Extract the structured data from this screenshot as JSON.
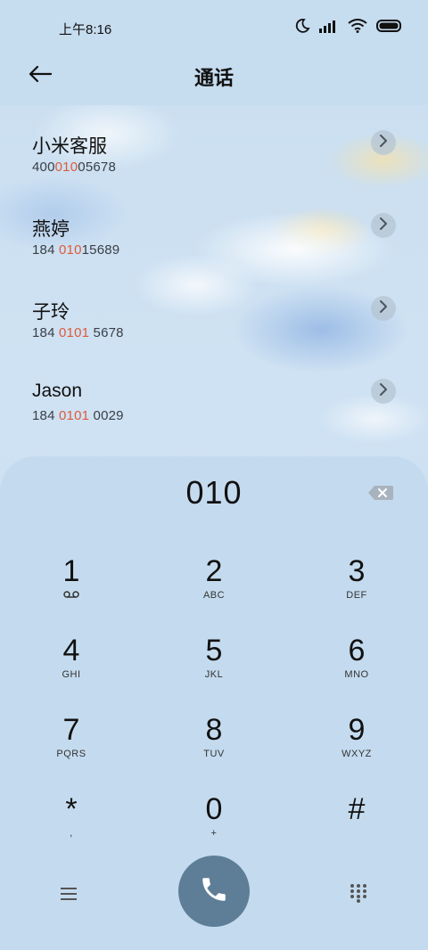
{
  "status": {
    "time": "上午8:16",
    "icons": [
      "moon-icon",
      "signal-icon",
      "wifi-icon",
      "battery-icon"
    ]
  },
  "header": {
    "title": "通话",
    "back_icon": "arrow-left-icon"
  },
  "contacts": [
    {
      "name": "小米客服",
      "number_pre": "400",
      "number_hl": "010",
      "number_post": "05678"
    },
    {
      "name": "燕婷",
      "number_pre": "184 ",
      "number_hl": "010",
      "number_post": "15689"
    },
    {
      "name": "子玲",
      "number_pre": "184 ",
      "number_hl": "0101",
      "number_post": " 5678"
    },
    {
      "name": "Jason",
      "number_pre": "184 ",
      "number_hl": "0101",
      "number_post": " 0029"
    }
  ],
  "dialpad": {
    "input": "010",
    "keys": [
      {
        "digit": "1",
        "letters": ""
      },
      {
        "digit": "2",
        "letters": "ABC"
      },
      {
        "digit": "3",
        "letters": "DEF"
      },
      {
        "digit": "4",
        "letters": "GHI"
      },
      {
        "digit": "5",
        "letters": "JKL"
      },
      {
        "digit": "6",
        "letters": "MNO"
      },
      {
        "digit": "7",
        "letters": "PQRS"
      },
      {
        "digit": "8",
        "letters": "TUV"
      },
      {
        "digit": "9",
        "letters": "WXYZ"
      },
      {
        "digit": "*",
        "letters": ","
      },
      {
        "digit": "0",
        "letters": "+"
      },
      {
        "digit": "#",
        "letters": ""
      }
    ]
  },
  "colors": {
    "highlight": "#e05a3a",
    "call_button": "#5e7e97",
    "panel": "#c4dbef"
  }
}
